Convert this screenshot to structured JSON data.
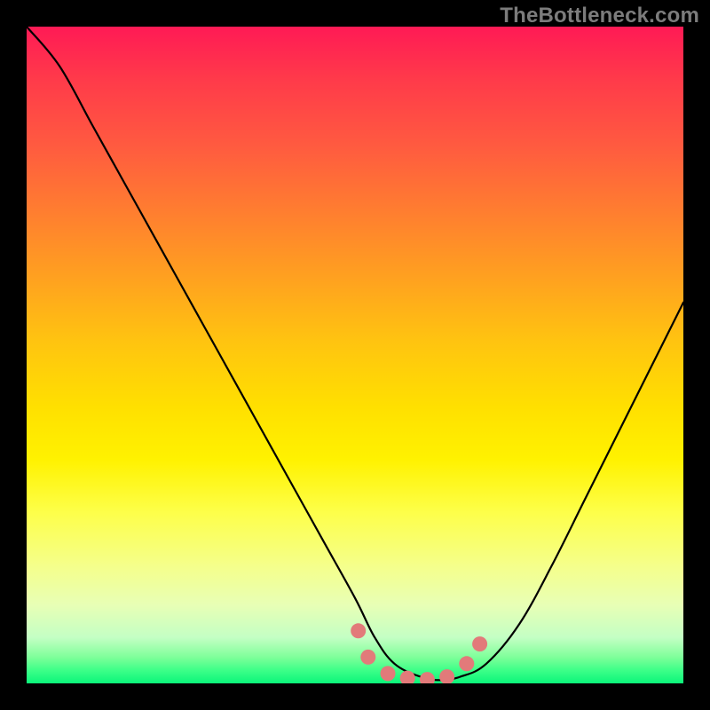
{
  "watermark": "TheBottleneck.com",
  "chart_data": {
    "type": "line",
    "title": "",
    "xlabel": "",
    "ylabel": "",
    "xlim": [
      0,
      100
    ],
    "ylim": [
      0,
      100
    ],
    "grid": false,
    "annotations": [],
    "series": [
      {
        "name": "bottleneck-curve",
        "color": "#000000",
        "x": [
          0,
          5,
          10,
          15,
          20,
          25,
          30,
          35,
          40,
          45,
          50,
          53,
          56,
          60,
          63,
          66,
          70,
          75,
          80,
          85,
          90,
          95,
          100
        ],
        "y": [
          100,
          94,
          85,
          76,
          67,
          58,
          49,
          40,
          31,
          22,
          13,
          7,
          3,
          1,
          0.5,
          1,
          3,
          9,
          18,
          28,
          38,
          48,
          58
        ]
      }
    ],
    "markers": {
      "name": "optimal-zone",
      "color": "#e27a7a",
      "x": [
        50.5,
        52,
        55,
        58,
        61,
        64,
        67,
        69
      ],
      "y": [
        8,
        4,
        1.5,
        0.8,
        0.6,
        1,
        3,
        6
      ]
    },
    "background_gradient": [
      {
        "pos": 0.0,
        "color": "#ff1a55"
      },
      {
        "pos": 0.5,
        "color": "#ffd400"
      },
      {
        "pos": 0.8,
        "color": "#fbff60"
      },
      {
        "pos": 1.0,
        "color": "#0bf57a"
      }
    ]
  }
}
